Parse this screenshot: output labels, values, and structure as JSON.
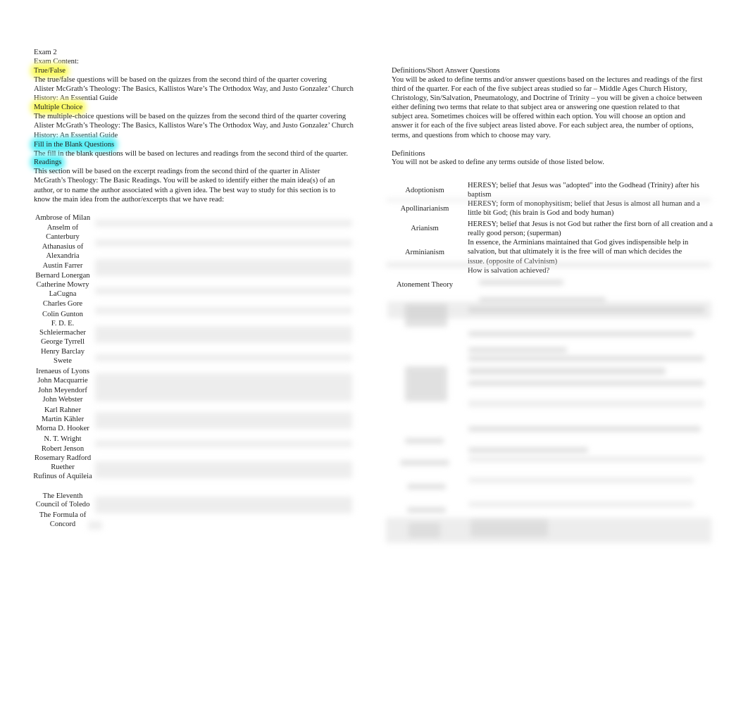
{
  "left": {
    "title": "Exam 2",
    "subtitle": "Exam Content:",
    "true_false": {
      "heading": "True/False",
      "lines": [
        "The true/false questions will be based on the quizzes  from the second third of the quarter covering",
        "Alister McGrath’s Theology: The Basics, Kallistos Ware’s The Orthodox Way, and Justo Gonzalez’ Church",
        "History: An Essential Guide"
      ]
    },
    "multiple_choice": {
      "heading": "Multiple Choice",
      "lines": [
        "The multiple-choice questions will be based on the quizzes  from the second third of the quarter covering",
        "Alister McGrath’s Theology: The Basics, Kallistos Ware’s The Orthodox Way, and Justo Gonzalez’ Church",
        "History: An Essential Guide"
      ]
    },
    "fill_blank": {
      "heading": "Fill in the Blank Questions",
      "lines": [
        "The fill in the blank questions will be based on lectures and readings  from the second third of the quarter."
      ]
    },
    "readings": {
      "heading": "Readings",
      "lines": [
        "This section will be based on the excerpt readings  from the second third of the quarter in Alister",
        "McGrath’s Theology: The Basic Readings. You will be asked to identify either the main idea(s) of an",
        "author, or to name the author associated with a given idea. The best way to study for this section is to",
        "know the main idea from the author/excerpts that we have read:"
      ]
    },
    "authors": [
      "Ambrose of Milan",
      "Anselm of Canterbury",
      "Athanasius of Alexandria",
      "Austin Farrer",
      "Bernard Lonergan",
      "Catherine Mowry LaCugna",
      "Charles Gore",
      "Colin Gunton",
      "F. D. E. Schleiermacher",
      "George Tyrrell",
      "Henry Barclay Swete",
      "Irenaeus of Lyons",
      "John Macquarrie",
      "John Meyendorf",
      "John Webster",
      "Karl Rahner",
      "Martin Kähler",
      "Morna D. Hooker",
      "N. T. Wright",
      "Robert Jenson",
      "Rosemary Radford Ruether",
      "Rufinus of Aquileia",
      "The Eleventh Council of Toledo",
      "The Formula of Concord"
    ]
  },
  "right": {
    "short_answer": {
      "heading": "Definitions/Short Answer Questions",
      "lines": [
        "You will be asked to define terms and/or answer questions based on the lectures and readings      of the first",
        "third of the quarter.   For each of the five subject areas studied so far – Middle Ages Church History,",
        "Christology, Sin/Salvation, Pneumatology, and Doctrine of Trinity – you will be given a choice between",
        "either defining two terms that relate to that subject area     or answering one question related to that",
        "subject area. Sometimes choices will be offered within each option. You will choose an option and",
        "answer it for each of the five subject areas listed above. For each subject area, the number of options,",
        "terms, and questions from which to choose may vary."
      ]
    },
    "definitions": {
      "heading": "Definitions",
      "note": "You will not be asked to define any terms outside of those listed below.",
      "rows": [
        {
          "term": "Adoptionism",
          "definition": "HERESY; belief that Jesus was \"adopted\" into the Godhead (Trinity) after his baptism"
        },
        {
          "term": "Apollinarianism",
          "definition": "HERESY; form of monophysitism; belief that Jesus is almost all human and a little bit God; (his brain is God and body human)"
        },
        {
          "term": "Arianism",
          "definition": "HERESY; belief that Jesus is not God but rather the first born of all creation and a really good person; (superman)"
        },
        {
          "term": "Arminianism",
          "definition": "In essence, the Arminians maintained that God gives indispensible help in salvation, but that ultimately it is the free will of man which decides the issue. (opposite of Calvinism)"
        },
        {
          "term": "Atonement Theory",
          "definition": "How is salvation achieved?"
        }
      ]
    }
  },
  "colors": {
    "highlight_yellow": "#fbfb6a",
    "highlight_cyan": "#5ff0f6"
  }
}
